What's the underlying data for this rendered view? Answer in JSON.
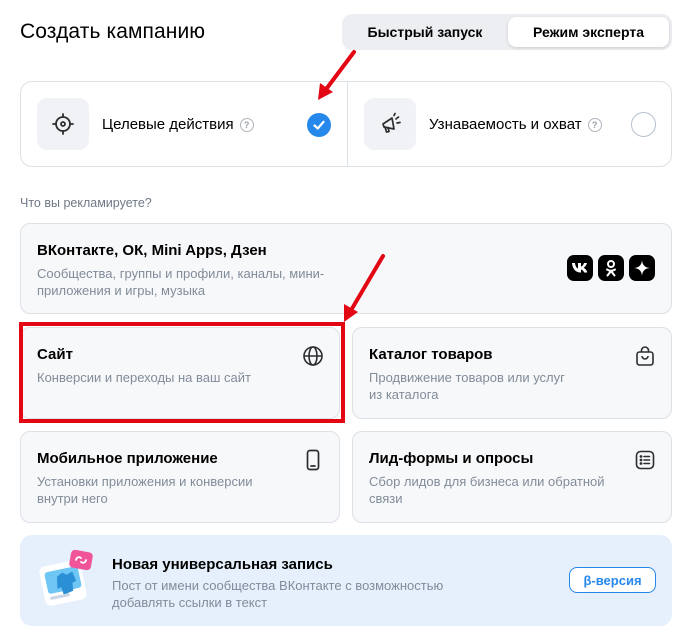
{
  "header": {
    "title": "Создать кампанию",
    "tabs": [
      {
        "label": "Быстрый запуск",
        "active": false
      },
      {
        "label": "Режим эксперта",
        "active": true
      }
    ]
  },
  "goals": {
    "options": [
      {
        "label": "Целевые действия",
        "help": "?",
        "selected": true,
        "icon": "target-icon"
      },
      {
        "label": "Узнаваемость и охват",
        "help": "?",
        "selected": false,
        "icon": "megaphone-icon"
      }
    ]
  },
  "promote": {
    "question": "Что вы рекламируете?",
    "vk": {
      "title": "ВКонтакте, ОК, Mini Apps, Дзен",
      "desc_line1": "Сообщества, группы и профили, каналы, мини-",
      "desc_line2": "приложения и игры, музыка",
      "icons": [
        "vk-icon",
        "ok-icon",
        "dzen-icon"
      ]
    },
    "site": {
      "title": "Сайт",
      "desc_line1": "Конверсии и переходы на ваш сайт",
      "icon": "globe-icon",
      "highlighted": true
    },
    "catalog": {
      "title": "Каталог товаров",
      "desc_line1": "Продвижение товаров или услуг",
      "desc_line2": "из каталога",
      "icon": "shopping-bag-icon"
    },
    "mobile": {
      "title": "Мобильное приложение",
      "desc_line1": "Установки приложения и конверсии",
      "desc_line2": "внутри него",
      "icon": "phone-icon"
    },
    "leads": {
      "title": "Лид-формы и опросы",
      "desc_line1": "Сбор лидов для бизнеса или обратной",
      "desc_line2": "связи",
      "icon": "form-list-icon"
    }
  },
  "banner": {
    "title": "Новая универсальная запись",
    "desc_line1": "Пост от имени сообщества ВКонтакте с возможностью",
    "desc_line2": "добавлять ссылки в текст",
    "button": "β-версия"
  },
  "colors": {
    "accent": "#2688eb",
    "highlight": "#e30613",
    "banner_bg": "#e6f0fd",
    "card_bg": "#f7f8fa"
  }
}
